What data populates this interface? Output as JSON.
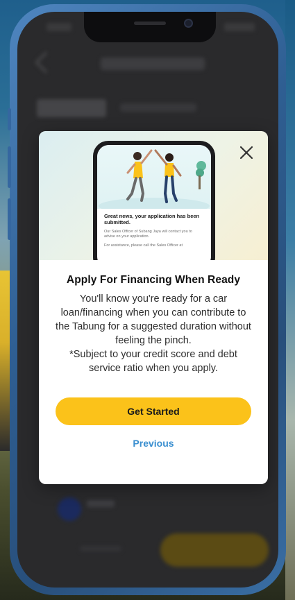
{
  "modal": {
    "title": "Apply For Financing When Ready",
    "body": "You'll know you're ready for a car loan/financing when you can contribute to the Tabung for a suggested duration without feeling the pinch.",
    "note": "*Subject to your credit score and debt service ratio when you apply.",
    "primary_label": "Get Started",
    "secondary_label": "Previous",
    "close_icon": "close-icon"
  },
  "illustration": {
    "headline": "Great news, your application has been submitted.",
    "body": "Our Sales Officer of Subang Jaya will contact you to advise on your application.",
    "body2": "For assistance, please call the Sales Officer at"
  },
  "colors": {
    "accent": "#fbc21a",
    "link": "#3a8fd0",
    "phone_frame": "#2f5f93"
  }
}
